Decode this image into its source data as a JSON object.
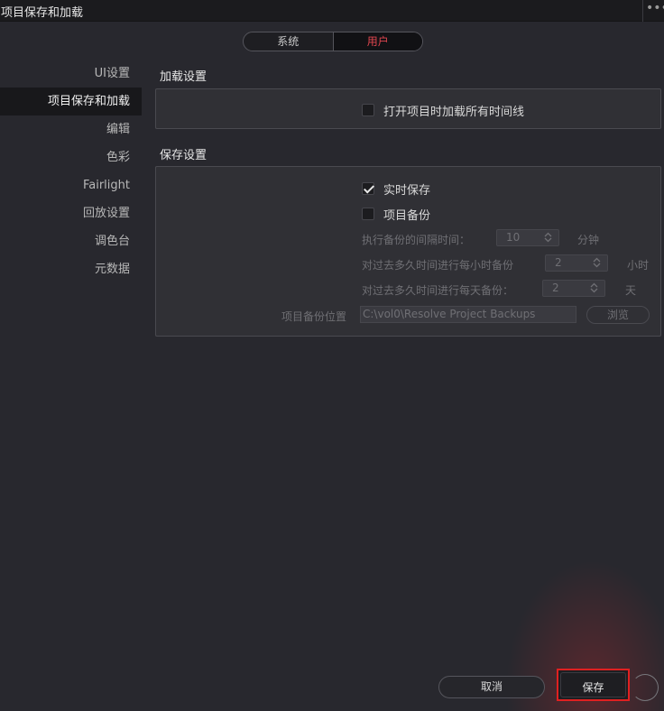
{
  "window": {
    "title": "项目保存和加载",
    "more_glyph": "•••"
  },
  "tabs": [
    {
      "label": "系统",
      "active": false
    },
    {
      "label": "用户",
      "active": true
    }
  ],
  "sidebar": {
    "items": [
      {
        "label": "UI设置"
      },
      {
        "label": "项目保存和加载",
        "active": true
      },
      {
        "label": "编辑"
      },
      {
        "label": "色彩"
      },
      {
        "label": "Fairlight"
      },
      {
        "label": "回放设置"
      },
      {
        "label": "调色台"
      },
      {
        "label": "元数据"
      }
    ]
  },
  "load_settings": {
    "title": "加载设置",
    "load_all_timelines": {
      "label": "打开项目时加载所有时间线",
      "checked": false
    }
  },
  "save_settings": {
    "title": "保存设置",
    "live_save": {
      "label": "实时保存",
      "checked": true
    },
    "project_backup": {
      "label": "项目备份",
      "checked": false
    },
    "backup_interval": {
      "label": "执行备份的间隔时间：",
      "value": "10",
      "unit": "分钟"
    },
    "hourly_backup": {
      "label": "对过去多久时间进行每小时备份",
      "value": "2",
      "unit": "小时"
    },
    "daily_backup": {
      "label": "对过去多久时间进行每天备份：",
      "value": "2",
      "unit": "天"
    },
    "backup_location": {
      "label": "项目备份位置",
      "value": "C:\\vol0\\Resolve Project Backups",
      "browse": "浏览"
    }
  },
  "footer": {
    "cancel": "取消",
    "save": "保存"
  },
  "colors": {
    "accent_tab": "#e0464f",
    "highlight_box": "#e02020"
  }
}
